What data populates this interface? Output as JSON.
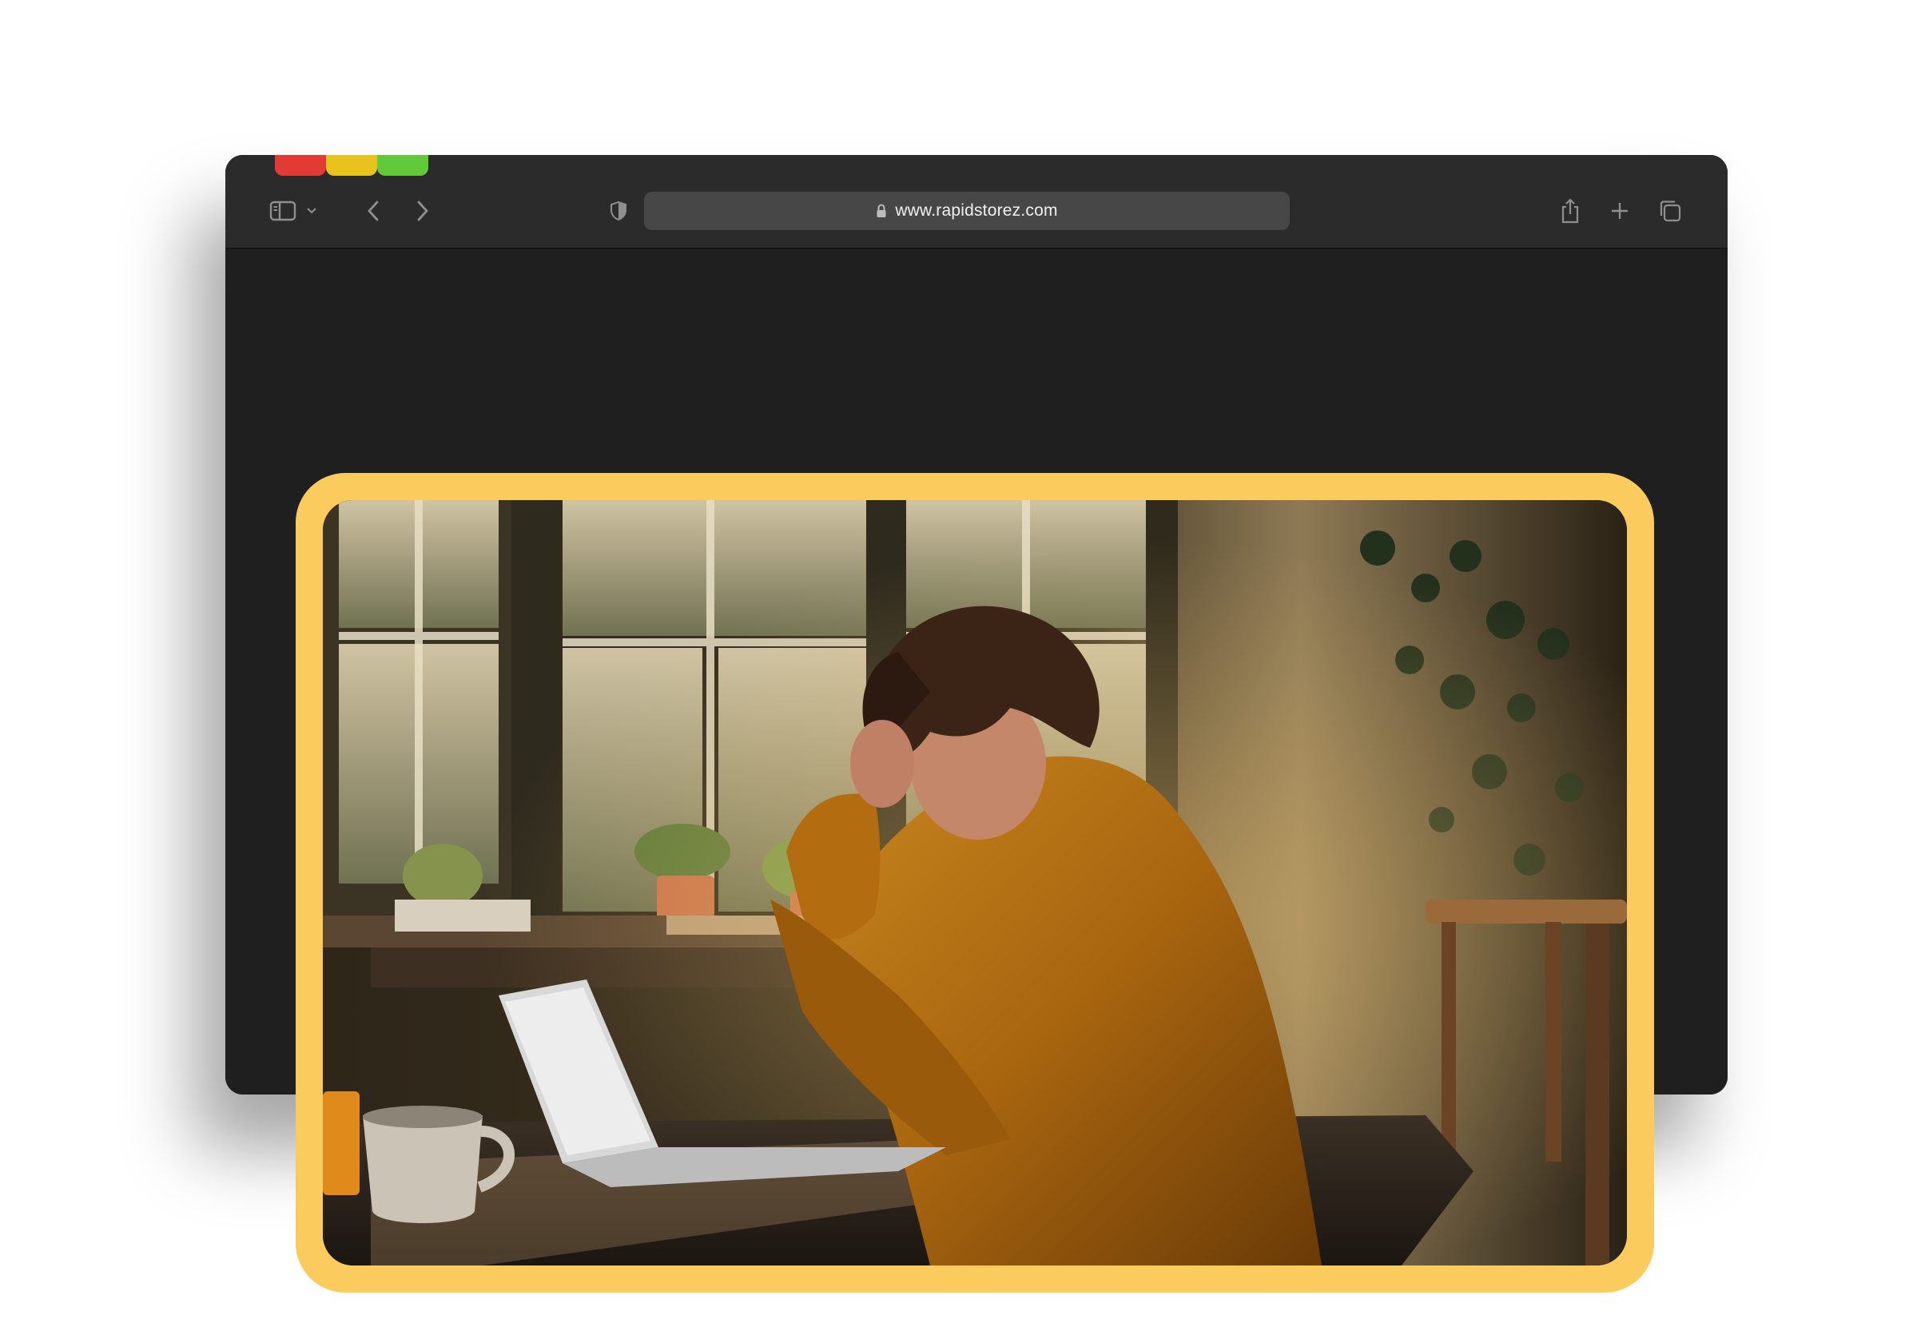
{
  "window": {
    "traffic_lights": {
      "close_color": "#e23b33",
      "minimize_color": "#e8c21d",
      "zoom_color": "#62c93a"
    }
  },
  "toolbar": {
    "sidebar_icon": "sidebar-icon",
    "sidebar_menu_icon": "chevron-down-icon",
    "back_icon": "chevron-left-icon",
    "forward_icon": "chevron-right-icon",
    "privacy_icon": "shield-icon",
    "share_icon": "share-icon",
    "new_tab_icon": "plus-icon",
    "tabs_icon": "tabs-overview-icon"
  },
  "address_bar": {
    "url": "www.rapidstorez.com",
    "lock_icon": "lock-icon"
  },
  "hero_image": {
    "frame_color": "#fccb5d"
  }
}
